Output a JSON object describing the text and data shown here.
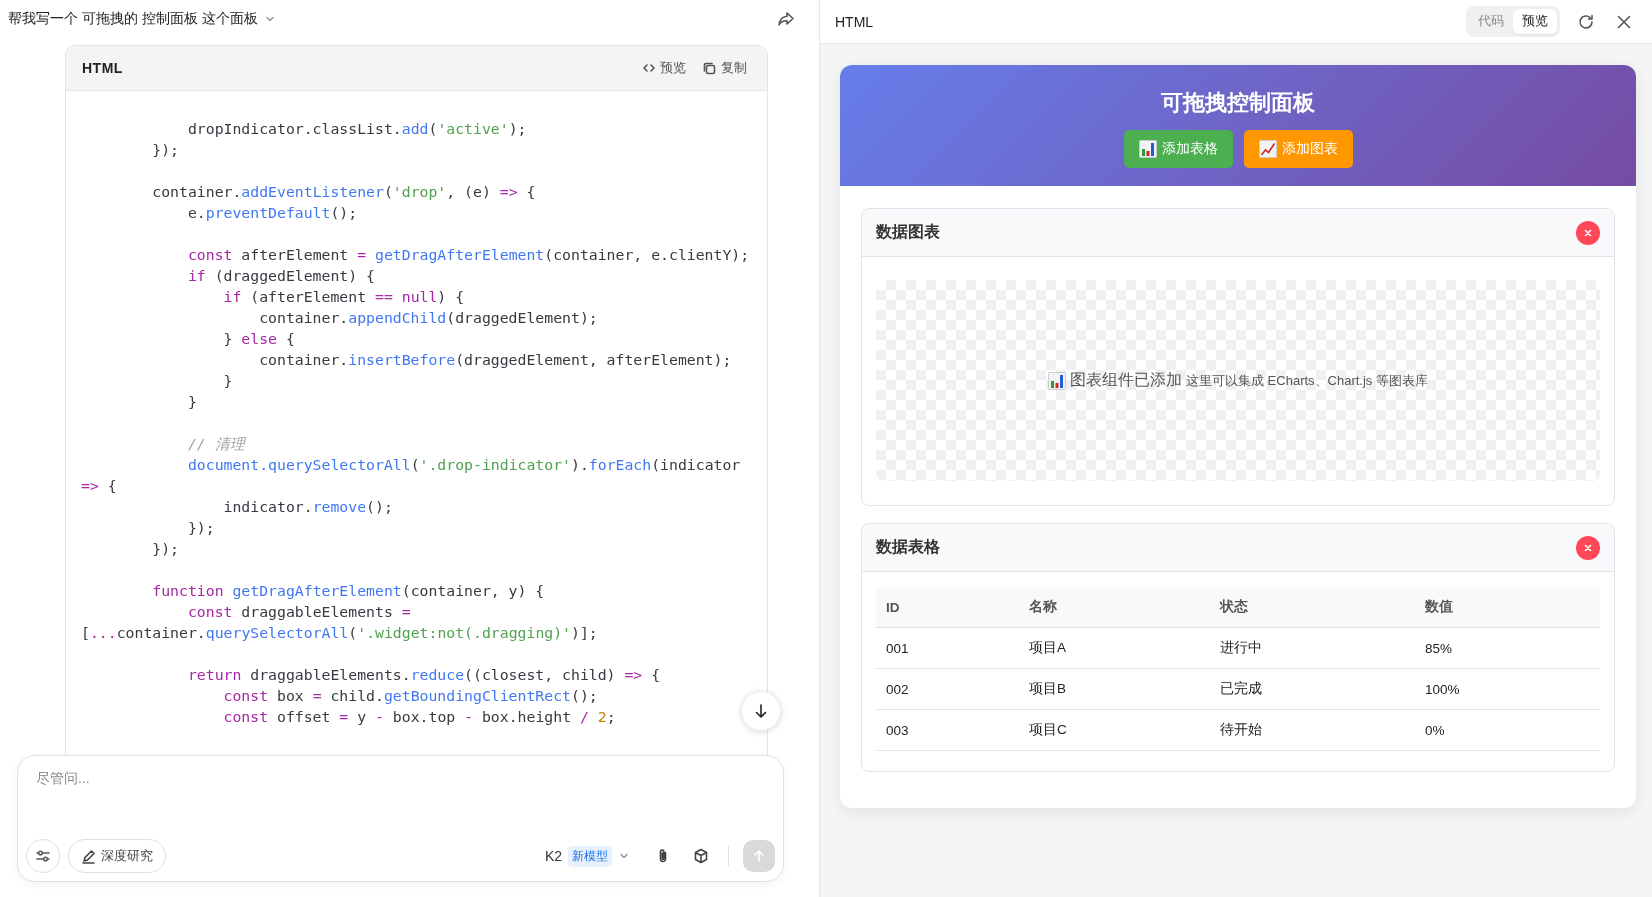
{
  "chat": {
    "title": "帮我写一个 可拖拽的 控制面板 这个面板",
    "code_block": {
      "language": "HTML",
      "actions": [
        {
          "kind": "preview",
          "label": "预览"
        },
        {
          "kind": "copy",
          "label": "复制"
        }
      ],
      "lines": [
        {
          "kind": "code",
          "tokens": [
            {
              "kind": "plain",
              "text": "            dropIndicator.classList."
            },
            {
              "kind": "function",
              "text": "add"
            },
            {
              "kind": "plain",
              "text": "("
            },
            {
              "kind": "string",
              "text": "'active'"
            },
            {
              "kind": "plain",
              "text": ");"
            }
          ]
        },
        {
          "kind": "code",
          "tokens": [
            {
              "kind": "plain",
              "text": "        });"
            }
          ]
        },
        {
          "kind": "blank"
        },
        {
          "kind": "code",
          "tokens": [
            {
              "kind": "plain",
              "text": "        container."
            },
            {
              "kind": "function",
              "text": "addEventListener"
            },
            {
              "kind": "plain",
              "text": "("
            },
            {
              "kind": "string",
              "text": "'drop'"
            },
            {
              "kind": "plain",
              "text": ", (e) "
            },
            {
              "kind": "keyword",
              "text": "=>"
            },
            {
              "kind": "plain",
              "text": " {"
            }
          ]
        },
        {
          "kind": "code",
          "tokens": [
            {
              "kind": "plain",
              "text": "            e."
            },
            {
              "kind": "function",
              "text": "preventDefault"
            },
            {
              "kind": "plain",
              "text": "();"
            }
          ]
        },
        {
          "kind": "blank"
        },
        {
          "kind": "code",
          "tokens": [
            {
              "kind": "keyword",
              "text": "            const"
            },
            {
              "kind": "plain",
              "text": " afterElement "
            },
            {
              "kind": "keyword",
              "text": "= "
            },
            {
              "kind": "function",
              "text": "getDragAfterElement"
            },
            {
              "kind": "plain",
              "text": "(container, e.clientY);"
            }
          ]
        },
        {
          "kind": "code",
          "tokens": [
            {
              "kind": "keyword",
              "text": "            if"
            },
            {
              "kind": "plain",
              "text": " (draggedElement) {"
            }
          ]
        },
        {
          "kind": "code",
          "tokens": [
            {
              "kind": "keyword",
              "text": "                if"
            },
            {
              "kind": "plain",
              "text": " (afterElement "
            },
            {
              "kind": "keyword",
              "text": "== null"
            },
            {
              "kind": "plain",
              "text": ") {"
            }
          ]
        },
        {
          "kind": "code",
          "tokens": [
            {
              "kind": "plain",
              "text": "                    container."
            },
            {
              "kind": "function",
              "text": "appendChild"
            },
            {
              "kind": "plain",
              "text": "(draggedElement);"
            }
          ]
        },
        {
          "kind": "code",
          "tokens": [
            {
              "kind": "plain",
              "text": "                } "
            },
            {
              "kind": "keyword",
              "text": "else"
            },
            {
              "kind": "plain",
              "text": " {"
            }
          ]
        },
        {
          "kind": "code",
          "tokens": [
            {
              "kind": "plain",
              "text": "                    container."
            },
            {
              "kind": "function",
              "text": "insertBefore"
            },
            {
              "kind": "plain",
              "text": "(draggedElement, afterElement);"
            }
          ]
        },
        {
          "kind": "code",
          "tokens": [
            {
              "kind": "plain",
              "text": "                }"
            }
          ]
        },
        {
          "kind": "code",
          "tokens": [
            {
              "kind": "plain",
              "text": "            }"
            }
          ]
        },
        {
          "kind": "blank"
        },
        {
          "kind": "code",
          "tokens": [
            {
              "kind": "comment",
              "text": "            // 清理"
            }
          ]
        },
        {
          "kind": "code",
          "tokens": [
            {
              "kind": "function",
              "text": "            document.querySelectorAll"
            },
            {
              "kind": "plain",
              "text": "("
            },
            {
              "kind": "string",
              "text": "'.drop-indicator'"
            },
            {
              "kind": "plain",
              "text": ")."
            },
            {
              "kind": "function",
              "text": "forEach"
            },
            {
              "kind": "plain",
              "text": "(indicator"
            }
          ]
        },
        {
          "kind": "code",
          "tokens": [
            {
              "kind": "keyword",
              "text": "=>"
            },
            {
              "kind": "plain",
              "text": " {"
            }
          ]
        },
        {
          "kind": "code",
          "tokens": [
            {
              "kind": "plain",
              "text": "                indicator."
            },
            {
              "kind": "function",
              "text": "remove"
            },
            {
              "kind": "plain",
              "text": "();"
            }
          ]
        },
        {
          "kind": "code",
          "tokens": [
            {
              "kind": "plain",
              "text": "            });"
            }
          ]
        },
        {
          "kind": "code",
          "tokens": [
            {
              "kind": "plain",
              "text": "        });"
            }
          ]
        },
        {
          "kind": "blank"
        },
        {
          "kind": "code",
          "tokens": [
            {
              "kind": "keyword",
              "text": "        function"
            },
            {
              "kind": "function",
              "text": " getDragAfterElement"
            },
            {
              "kind": "plain",
              "text": "(container, y) {"
            }
          ]
        },
        {
          "kind": "code",
          "tokens": [
            {
              "kind": "keyword",
              "text": "            const"
            },
            {
              "kind": "plain",
              "text": " draggableElements "
            },
            {
              "kind": "keyword",
              "text": "="
            }
          ]
        },
        {
          "kind": "code",
          "tokens": [
            {
              "kind": "plain",
              "text": "["
            },
            {
              "kind": "keyword",
              "text": "..."
            },
            {
              "kind": "plain",
              "text": "container."
            },
            {
              "kind": "function",
              "text": "querySelectorAll"
            },
            {
              "kind": "plain",
              "text": "("
            },
            {
              "kind": "string",
              "text": "'.widget:not(.dragging)'"
            },
            {
              "kind": "plain",
              "text": ")];"
            }
          ]
        },
        {
          "kind": "blank"
        },
        {
          "kind": "code",
          "tokens": [
            {
              "kind": "keyword",
              "text": "            return"
            },
            {
              "kind": "plain",
              "text": " draggableElements."
            },
            {
              "kind": "function",
              "text": "reduce"
            },
            {
              "kind": "plain",
              "text": "((closest, child) "
            },
            {
              "kind": "keyword",
              "text": "=>"
            },
            {
              "kind": "plain",
              "text": " {"
            }
          ]
        },
        {
          "kind": "code",
          "tokens": [
            {
              "kind": "keyword",
              "text": "                const"
            },
            {
              "kind": "plain",
              "text": " box "
            },
            {
              "kind": "keyword",
              "text": "="
            },
            {
              "kind": "plain",
              "text": " child."
            },
            {
              "kind": "function",
              "text": "getBoundingClientRect"
            },
            {
              "kind": "plain",
              "text": "();"
            }
          ]
        },
        {
          "kind": "code",
          "tokens": [
            {
              "kind": "keyword",
              "text": "                const"
            },
            {
              "kind": "plain",
              "text": " offset "
            },
            {
              "kind": "keyword",
              "text": "="
            },
            {
              "kind": "plain",
              "text": " y "
            },
            {
              "kind": "keyword",
              "text": "-"
            },
            {
              "kind": "plain",
              "text": " box.top "
            },
            {
              "kind": "keyword",
              "text": "-"
            },
            {
              "kind": "plain",
              "text": " box.height "
            },
            {
              "kind": "keyword",
              "text": "/"
            },
            {
              "kind": "number",
              "text": " 2"
            },
            {
              "kind": "plain",
              "text": ";"
            }
          ]
        }
      ]
    },
    "composer": {
      "placeholder": "尽管问...",
      "deep_research": "深度研究",
      "model": "K2",
      "model_badge": "新模型"
    }
  },
  "preview_panel": {
    "title": "HTML",
    "tabs": [
      {
        "label": "代码",
        "selected": false
      },
      {
        "label": "预览",
        "selected": true
      }
    ],
    "app": {
      "title": "可拖拽控制面板",
      "buttons": [
        {
          "kind": "table",
          "label": "添加表格"
        },
        {
          "kind": "chart",
          "label": "添加图表"
        }
      ],
      "widgets": [
        {
          "kind": "chart",
          "title": "数据图表",
          "heading": "图表组件已添加",
          "note": "这里可以集成 ECharts、Chart.js 等图表库"
        },
        {
          "kind": "table",
          "title": "数据表格",
          "columns": [
            "ID",
            "名称",
            "状态",
            "数值"
          ],
          "rows": [
            [
              "001",
              "项目A",
              "进行中",
              "85%"
            ],
            [
              "002",
              "项目B",
              "已完成",
              "100%"
            ],
            [
              "003",
              "项目C",
              "待开始",
              "0%"
            ]
          ]
        }
      ]
    }
  }
}
